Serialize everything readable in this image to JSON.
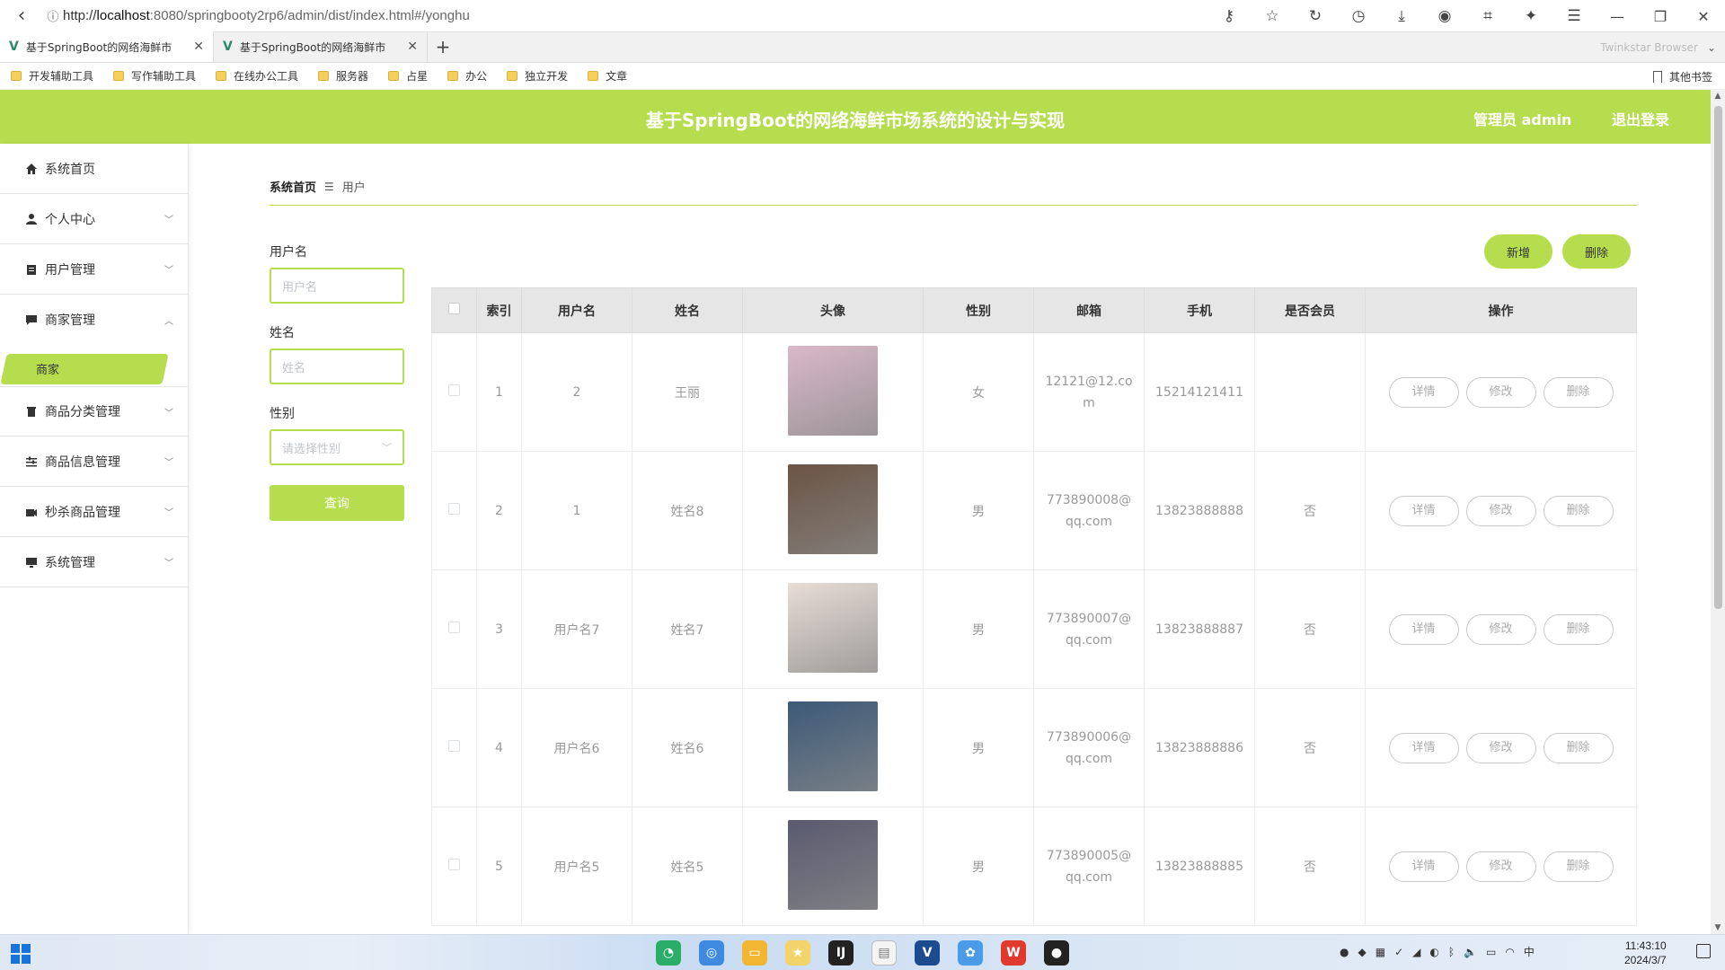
{
  "browser": {
    "url_prefix": "http://",
    "url_host": "localhost",
    "url_path": ":8080/springbooty2rp6/admin/dist/index.html#/yonghu",
    "tabs": [
      {
        "title": "基于SpringBoot的网络海鲜市"
      },
      {
        "title": "基于SpringBoot的网络海鲜市"
      }
    ],
    "brand": "Twinkstar Browser",
    "bookmarks": [
      "开发辅助工具",
      "写作辅助工具",
      "在线办公工具",
      "服务器",
      "占星",
      "办公",
      "独立开发",
      "文章"
    ],
    "other_bookmarks": "其他书签"
  },
  "header": {
    "title": "基于SpringBoot的网络海鲜市场系统的设计与实现",
    "user": "管理员 admin",
    "logout": "退出登录"
  },
  "sidebar": {
    "items": [
      {
        "label": "系统首页",
        "icon": "home-icon"
      },
      {
        "label": "个人中心",
        "icon": "user-icon"
      },
      {
        "label": "用户管理",
        "icon": "clipboard-icon"
      },
      {
        "label": "商家管理",
        "icon": "chat-icon"
      },
      {
        "label": "商品分类管理",
        "icon": "trash-icon"
      },
      {
        "label": "商品信息管理",
        "icon": "sliders-icon"
      },
      {
        "label": "秒杀商品管理",
        "icon": "camera-icon"
      },
      {
        "label": "系统管理",
        "icon": "monitor-icon"
      }
    ],
    "sub_item": "商家"
  },
  "breadcrumb": {
    "home": "系统首页",
    "sep": "☰",
    "current": "用户"
  },
  "search": {
    "username_label": "用户名",
    "username_placeholder": "用户名",
    "name_label": "姓名",
    "name_placeholder": "姓名",
    "gender_label": "性别",
    "gender_placeholder": "请选择性别",
    "query_button": "查询"
  },
  "actions": {
    "add": "新增",
    "delete": "删除"
  },
  "table": {
    "headers": [
      "索引",
      "用户名",
      "姓名",
      "头像",
      "性别",
      "邮箱",
      "手机",
      "是否会员",
      "操作"
    ],
    "rows": [
      {
        "index": "1",
        "username": "2",
        "name": "王丽",
        "gender": "女",
        "email": "12121@12.com",
        "phone": "15214121411",
        "member": "",
        "avatar_color": "#d9b8c8"
      },
      {
        "index": "2",
        "username": "1",
        "name": "姓名8",
        "gender": "男",
        "email": "773890008@qq.com",
        "phone": "13823888888",
        "member": "否",
        "avatar_color": "#6b5444"
      },
      {
        "index": "3",
        "username": "用户名7",
        "name": "姓名7",
        "gender": "男",
        "email": "773890007@qq.com",
        "phone": "13823888887",
        "member": "否",
        "avatar_color": "#e8dcd6"
      },
      {
        "index": "4",
        "username": "用户名6",
        "name": "姓名6",
        "gender": "男",
        "email": "773890006@qq.com",
        "phone": "13823888886",
        "member": "否",
        "avatar_color": "#3d5a78"
      },
      {
        "index": "5",
        "username": "用户名5",
        "name": "姓名5",
        "gender": "男",
        "email": "773890005@qq.com",
        "phone": "13823888885",
        "member": "否",
        "avatar_color": "#5a5a70"
      }
    ],
    "row_actions": {
      "detail": "详情",
      "edit": "修改",
      "delete": "删除"
    }
  },
  "taskbar": {
    "time": "11:43:10",
    "date": "2024/3/7"
  },
  "colors": {
    "accent": "#b5dd4e"
  }
}
